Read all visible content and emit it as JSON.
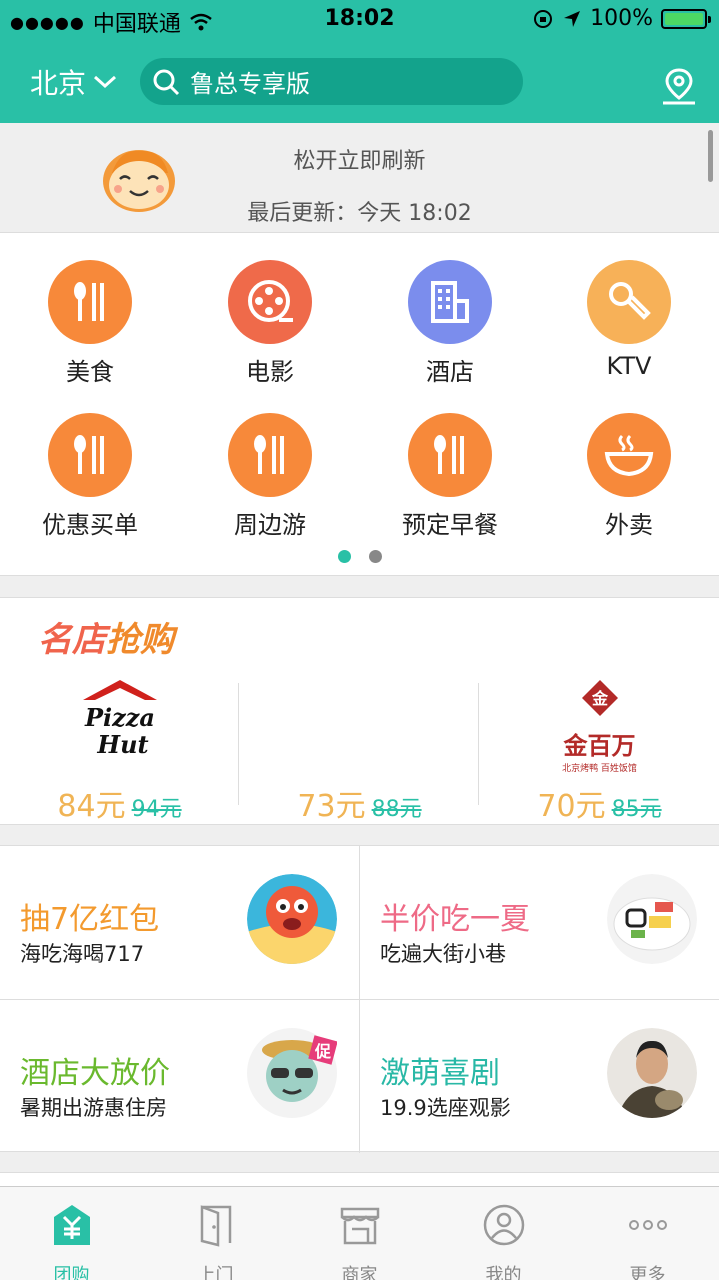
{
  "status_bar": {
    "carrier": "中国联通",
    "time": "18:02",
    "battery": "100%"
  },
  "header": {
    "city": "北京",
    "search_text": "鲁总专享版"
  },
  "refresh": {
    "line1": "松开立即刷新",
    "line2": "最后更新：今天 18:02"
  },
  "categories": [
    {
      "label": "美食",
      "color": "#f7893a",
      "icon": "fork-knife-icon"
    },
    {
      "label": "电影",
      "color": "#ef6a4a",
      "icon": "film-reel-icon"
    },
    {
      "label": "酒店",
      "color": "#7b8ded",
      "icon": "building-icon"
    },
    {
      "label": "KTV",
      "color": "#f7b158",
      "icon": "microphone-icon"
    },
    {
      "label": "优惠买单",
      "color": "#f7893a",
      "icon": "fork-knife-icon"
    },
    {
      "label": "周边游",
      "color": "#f7893a",
      "icon": "fork-knife-icon"
    },
    {
      "label": "预定早餐",
      "color": "#f7893a",
      "icon": "fork-knife-icon"
    },
    {
      "label": "外卖",
      "color": "#f7893a",
      "icon": "bowl-icon"
    }
  ],
  "stores": {
    "title_part1": "名店",
    "title_part2": "抢购",
    "items": [
      {
        "logo_text": "Pizza Hut",
        "price": "84元",
        "old_price": "94元"
      },
      {
        "logo_text": "",
        "price": "73元",
        "old_price": "88元"
      },
      {
        "logo_text": "金百万",
        "logo_sub": "北京烤鸭 百姓饭馆",
        "price": "70元",
        "old_price": "85元"
      }
    ]
  },
  "promos": [
    {
      "title": "抽7亿红包",
      "subtitle": "海吃海喝717",
      "color": "#f39a2e"
    },
    {
      "title": "半价吃一夏",
      "subtitle": "吃遍大街小巷",
      "color": "#ee6a86"
    },
    {
      "title": "酒店大放价",
      "subtitle": "暑期出游惠住房",
      "color": "#6ab92e"
    },
    {
      "title": "激萌喜剧",
      "subtitle": "19.9选座观影",
      "color": "#29b8a6"
    }
  ],
  "promo_badge": "促",
  "tabs": [
    {
      "label": "团购",
      "active": true
    },
    {
      "label": "上门",
      "active": false
    },
    {
      "label": "商家",
      "active": false
    },
    {
      "label": "我的",
      "active": false
    },
    {
      "label": "更多",
      "active": false
    }
  ],
  "colors": {
    "accent": "#29c0a6",
    "price": "#f0b455"
  }
}
